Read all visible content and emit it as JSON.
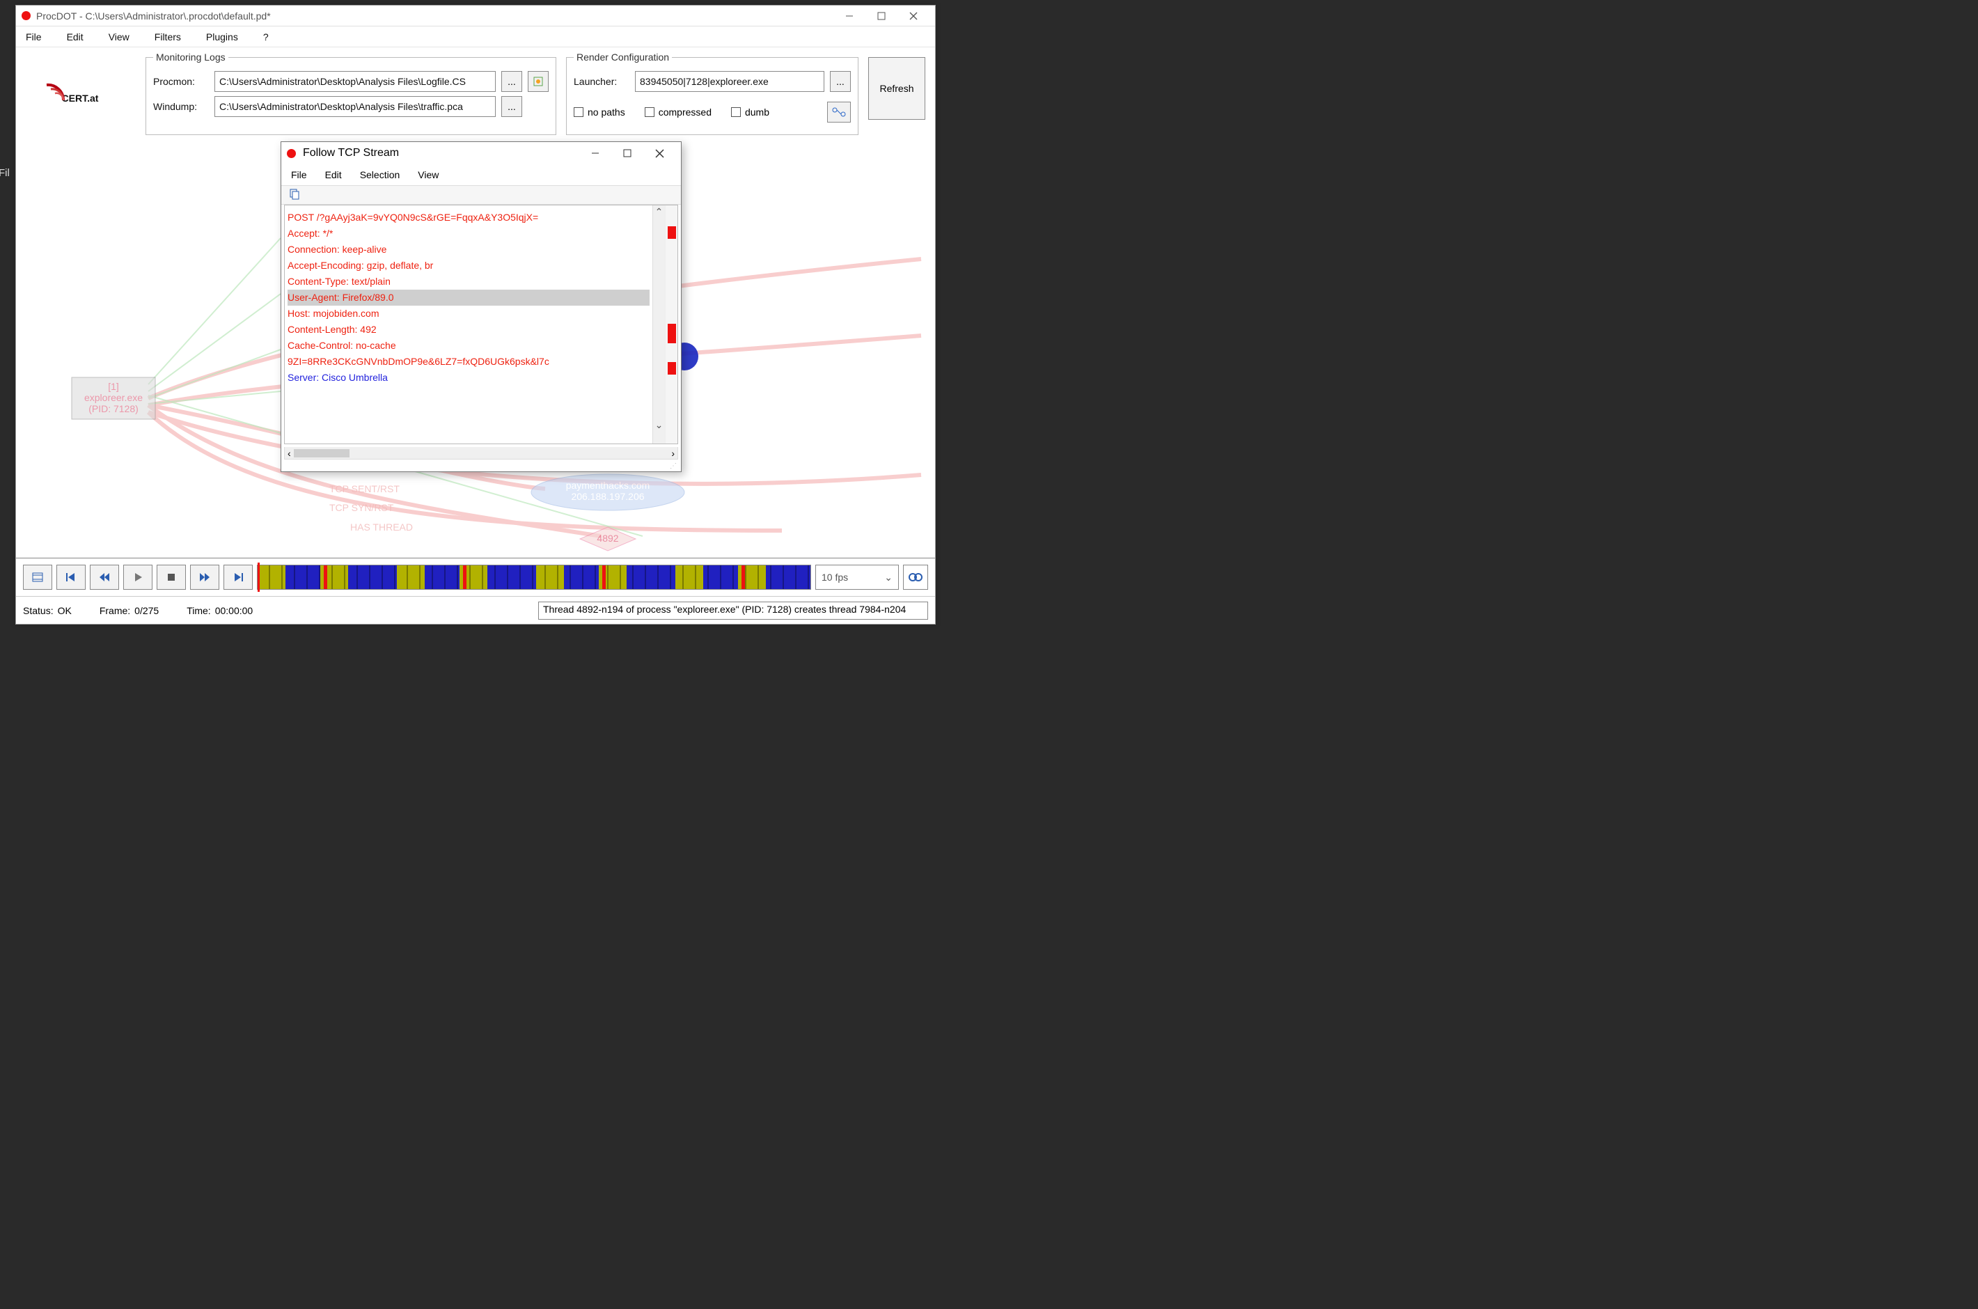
{
  "window": {
    "title": "ProcDOT - C:\\Users\\Administrator\\.procdot\\default.pd*"
  },
  "menu": {
    "file": "File",
    "edit": "Edit",
    "view": "View",
    "filters": "Filters",
    "plugins": "Plugins",
    "help": "?"
  },
  "logo_text": "CERT",
  "logo_suffix": ".at",
  "monitoring": {
    "legend": "Monitoring Logs",
    "procmon_label": "Procmon:",
    "procmon_value": "C:\\Users\\Administrator\\Desktop\\Analysis Files\\Logfile.CS",
    "windump_label": "Windump:",
    "windump_value": "C:\\Users\\Administrator\\Desktop\\Analysis Files\\traffic.pca",
    "browse": "..."
  },
  "render": {
    "legend": "Render Configuration",
    "launcher_label": "Launcher:",
    "launcher_value": "83945050|7128|exploreer.exe",
    "browse": "...",
    "no_paths": "no paths",
    "compressed": "compressed",
    "dumb": "dumb"
  },
  "refresh": "Refresh",
  "graph": {
    "proc_node_line1": "[1]",
    "proc_node_line2": "exploreer.exe",
    "proc_node_line3": "(PID: 7128)",
    "host_node_line1": "paymenthacks.com",
    "host_node_line2": "206.188.197.206",
    "label_tcp1": "TCP SENT/RST",
    "label_tcp2": "TCP SYN/RST",
    "label_thread": "HAS THREAD",
    "diamond": "4892"
  },
  "tcp": {
    "title": "Follow TCP Stream",
    "menu": {
      "file": "File",
      "edit": "Edit",
      "selection": "Selection",
      "view": "View"
    },
    "lines": [
      {
        "t": "POST /?gAAyj3aK=9vYQ0N9cS&rGE=FqqxA&Y3O5IqjX=",
        "c": "red"
      },
      {
        "t": "Accept: */*",
        "c": "red"
      },
      {
        "t": "Connection: keep-alive",
        "c": "red"
      },
      {
        "t": "Accept-Encoding: gzip, deflate, br",
        "c": "red"
      },
      {
        "t": "Content-Type: text/plain",
        "c": "red"
      },
      {
        "t": "User-Agent: Firefox/89.0",
        "c": "red",
        "hl": true
      },
      {
        "t": "Host: mojobiden.com",
        "c": "red"
      },
      {
        "t": "Content-Length: 492",
        "c": "red"
      },
      {
        "t": "Cache-Control: no-cache",
        "c": "red"
      },
      {
        "t": "",
        "c": "red"
      },
      {
        "t": "9ZI=8RRe3CKcGNVnbDmOP9e&6LZ7=fxQD6UGk6psk&l7c",
        "c": "red"
      },
      {
        "t": "Server: Cisco Umbrella",
        "c": "blue"
      }
    ]
  },
  "playbar": {
    "fps": "10 fps"
  },
  "status": {
    "status_label": "Status:",
    "status_value": "OK",
    "frame_label": "Frame:",
    "frame_value": "0/275",
    "time_label": "Time:",
    "time_value": "00:00:00",
    "message": "Thread 4892-n194 of process \"exploreer.exe\" (PID: 7128) creates thread 7984-n204"
  },
  "leftcut": "Fil"
}
